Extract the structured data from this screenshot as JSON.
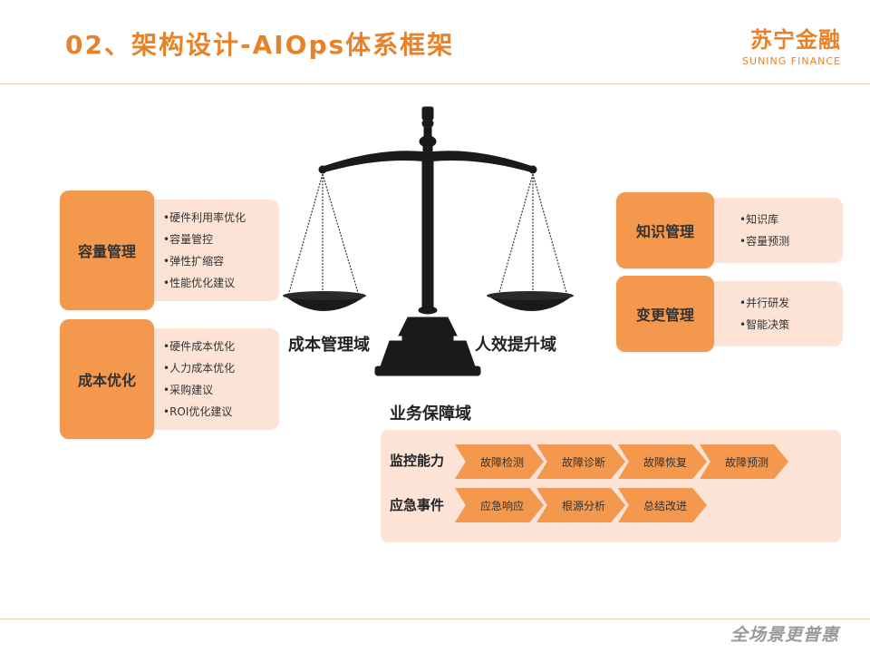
{
  "header": {
    "title": "02、架构设计-AIOps体系框架",
    "logo_main": "苏宁金融",
    "logo_sub": "SUNING FINANCE"
  },
  "scale": {
    "left_label": "成本管理域",
    "right_label": "人效提升域",
    "bottom_label": "业务保障域"
  },
  "left": {
    "capacity": {
      "title": "容量管理",
      "items": [
        "硬件利用率优化",
        "容量管控",
        "弹性扩缩容",
        "性能优化建议"
      ]
    },
    "cost": {
      "title": "成本优化",
      "items": [
        "硬件成本优化",
        "人力成本优化",
        "采购建议",
        "ROI优化建议"
      ]
    }
  },
  "right": {
    "knowledge": {
      "title": "知识管理",
      "items": [
        "知识库",
        "容量预测"
      ]
    },
    "change": {
      "title": "变更管理",
      "items": [
        "并行研发",
        "智能决策"
      ]
    }
  },
  "business": {
    "monitor": {
      "label": "监控能力",
      "steps": [
        "故障检测",
        "故障诊断",
        "故障恢复",
        "故障预测"
      ]
    },
    "emergency": {
      "label": "应急事件",
      "steps": [
        "应急响应",
        "根源分析",
        "总结改进"
      ]
    }
  },
  "footer": {
    "slogan": "全场景更普惠"
  },
  "colors": {
    "accent": "#e8822a",
    "box": "#f3984c",
    "panel": "#fde3d6"
  }
}
